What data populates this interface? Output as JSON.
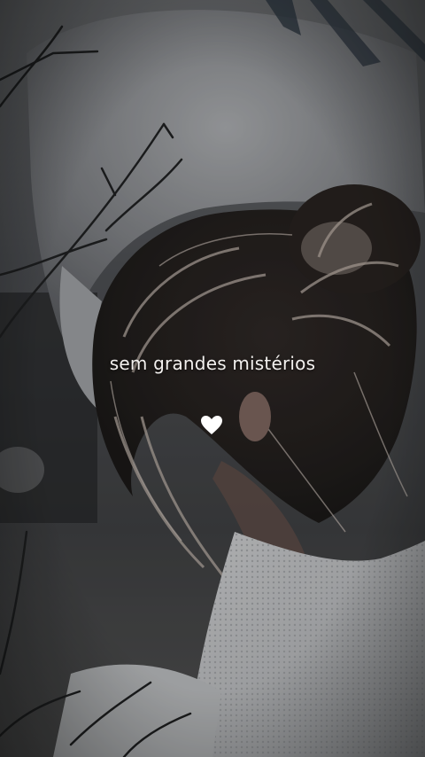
{
  "caption": "sem grandes mistérios",
  "heart_icon": "heart-icon",
  "colors": {
    "caption_text": "#f3f1ef",
    "heart": "#ffffff"
  }
}
